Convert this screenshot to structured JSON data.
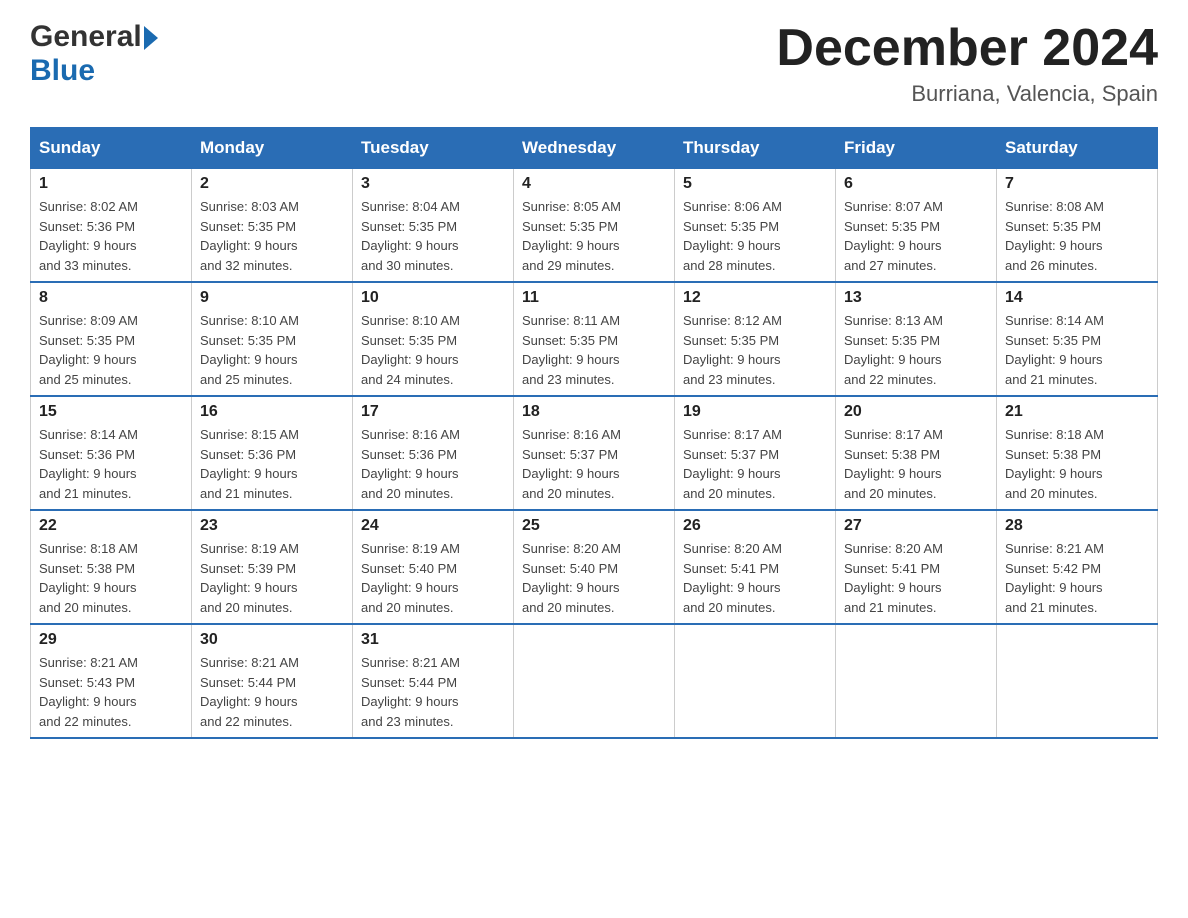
{
  "header": {
    "logo_general": "General",
    "logo_blue": "Blue",
    "month_title": "December 2024",
    "location": "Burriana, Valencia, Spain"
  },
  "days_of_week": [
    "Sunday",
    "Monday",
    "Tuesday",
    "Wednesday",
    "Thursday",
    "Friday",
    "Saturday"
  ],
  "weeks": [
    [
      {
        "day": "1",
        "sunrise": "8:02 AM",
        "sunset": "5:36 PM",
        "daylight": "9 hours and 33 minutes."
      },
      {
        "day": "2",
        "sunrise": "8:03 AM",
        "sunset": "5:35 PM",
        "daylight": "9 hours and 32 minutes."
      },
      {
        "day": "3",
        "sunrise": "8:04 AM",
        "sunset": "5:35 PM",
        "daylight": "9 hours and 30 minutes."
      },
      {
        "day": "4",
        "sunrise": "8:05 AM",
        "sunset": "5:35 PM",
        "daylight": "9 hours and 29 minutes."
      },
      {
        "day": "5",
        "sunrise": "8:06 AM",
        "sunset": "5:35 PM",
        "daylight": "9 hours and 28 minutes."
      },
      {
        "day": "6",
        "sunrise": "8:07 AM",
        "sunset": "5:35 PM",
        "daylight": "9 hours and 27 minutes."
      },
      {
        "day": "7",
        "sunrise": "8:08 AM",
        "sunset": "5:35 PM",
        "daylight": "9 hours and 26 minutes."
      }
    ],
    [
      {
        "day": "8",
        "sunrise": "8:09 AM",
        "sunset": "5:35 PM",
        "daylight": "9 hours and 25 minutes."
      },
      {
        "day": "9",
        "sunrise": "8:10 AM",
        "sunset": "5:35 PM",
        "daylight": "9 hours and 25 minutes."
      },
      {
        "day": "10",
        "sunrise": "8:10 AM",
        "sunset": "5:35 PM",
        "daylight": "9 hours and 24 minutes."
      },
      {
        "day": "11",
        "sunrise": "8:11 AM",
        "sunset": "5:35 PM",
        "daylight": "9 hours and 23 minutes."
      },
      {
        "day": "12",
        "sunrise": "8:12 AM",
        "sunset": "5:35 PM",
        "daylight": "9 hours and 23 minutes."
      },
      {
        "day": "13",
        "sunrise": "8:13 AM",
        "sunset": "5:35 PM",
        "daylight": "9 hours and 22 minutes."
      },
      {
        "day": "14",
        "sunrise": "8:14 AM",
        "sunset": "5:35 PM",
        "daylight": "9 hours and 21 minutes."
      }
    ],
    [
      {
        "day": "15",
        "sunrise": "8:14 AM",
        "sunset": "5:36 PM",
        "daylight": "9 hours and 21 minutes."
      },
      {
        "day": "16",
        "sunrise": "8:15 AM",
        "sunset": "5:36 PM",
        "daylight": "9 hours and 21 minutes."
      },
      {
        "day": "17",
        "sunrise": "8:16 AM",
        "sunset": "5:36 PM",
        "daylight": "9 hours and 20 minutes."
      },
      {
        "day": "18",
        "sunrise": "8:16 AM",
        "sunset": "5:37 PM",
        "daylight": "9 hours and 20 minutes."
      },
      {
        "day": "19",
        "sunrise": "8:17 AM",
        "sunset": "5:37 PM",
        "daylight": "9 hours and 20 minutes."
      },
      {
        "day": "20",
        "sunrise": "8:17 AM",
        "sunset": "5:38 PM",
        "daylight": "9 hours and 20 minutes."
      },
      {
        "day": "21",
        "sunrise": "8:18 AM",
        "sunset": "5:38 PM",
        "daylight": "9 hours and 20 minutes."
      }
    ],
    [
      {
        "day": "22",
        "sunrise": "8:18 AM",
        "sunset": "5:38 PM",
        "daylight": "9 hours and 20 minutes."
      },
      {
        "day": "23",
        "sunrise": "8:19 AM",
        "sunset": "5:39 PM",
        "daylight": "9 hours and 20 minutes."
      },
      {
        "day": "24",
        "sunrise": "8:19 AM",
        "sunset": "5:40 PM",
        "daylight": "9 hours and 20 minutes."
      },
      {
        "day": "25",
        "sunrise": "8:20 AM",
        "sunset": "5:40 PM",
        "daylight": "9 hours and 20 minutes."
      },
      {
        "day": "26",
        "sunrise": "8:20 AM",
        "sunset": "5:41 PM",
        "daylight": "9 hours and 20 minutes."
      },
      {
        "day": "27",
        "sunrise": "8:20 AM",
        "sunset": "5:41 PM",
        "daylight": "9 hours and 21 minutes."
      },
      {
        "day": "28",
        "sunrise": "8:21 AM",
        "sunset": "5:42 PM",
        "daylight": "9 hours and 21 minutes."
      }
    ],
    [
      {
        "day": "29",
        "sunrise": "8:21 AM",
        "sunset": "5:43 PM",
        "daylight": "9 hours and 22 minutes."
      },
      {
        "day": "30",
        "sunrise": "8:21 AM",
        "sunset": "5:44 PM",
        "daylight": "9 hours and 22 minutes."
      },
      {
        "day": "31",
        "sunrise": "8:21 AM",
        "sunset": "5:44 PM",
        "daylight": "9 hours and 23 minutes."
      },
      null,
      null,
      null,
      null
    ]
  ]
}
